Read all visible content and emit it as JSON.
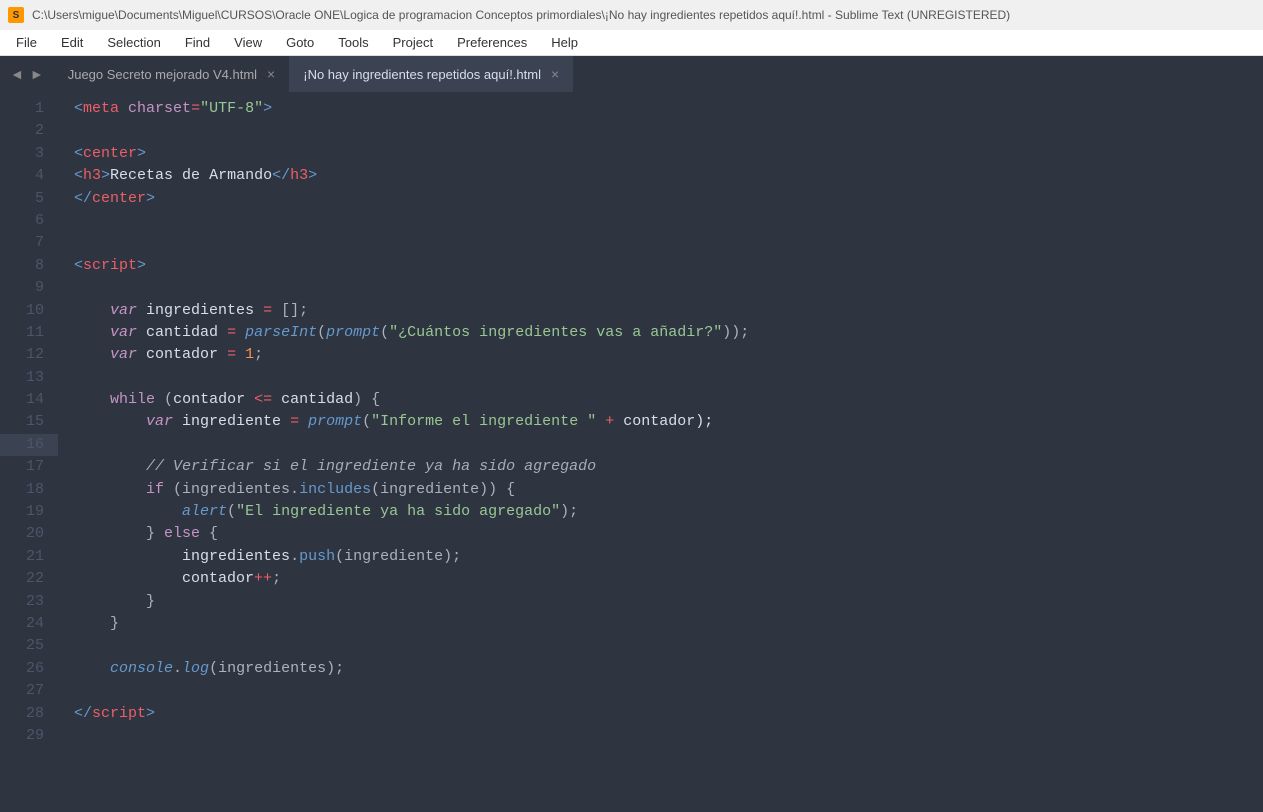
{
  "title_bar": "C:\\Users\\migue\\Documents\\Miguel\\CURSOS\\Oracle ONE\\Logica de programacion Conceptos primordiales\\¡No hay ingredientes repetidos aquí!.html - Sublime Text (UNREGISTERED)",
  "menu": [
    "File",
    "Edit",
    "Selection",
    "Find",
    "View",
    "Goto",
    "Tools",
    "Project",
    "Preferences",
    "Help"
  ],
  "tabs": [
    {
      "label": "Juego Secreto mejorado V4.html",
      "active": false
    },
    {
      "label": "¡No hay ingredientes repetidos aquí!.html",
      "active": true
    }
  ],
  "line_numbers": [
    1,
    2,
    3,
    4,
    5,
    6,
    7,
    8,
    9,
    10,
    11,
    12,
    13,
    14,
    15,
    16,
    17,
    18,
    19,
    20,
    21,
    22,
    23,
    24,
    25,
    26,
    27,
    28,
    29
  ],
  "modified_lines": [
    1,
    3,
    4,
    5,
    7,
    14,
    16,
    17,
    18,
    19,
    20,
    21,
    22,
    23,
    24,
    26
  ],
  "highlighted_line": 16,
  "code": {
    "l1": {
      "charset_attr": "charset",
      "charset_val": "\"UTF-8\""
    },
    "l4": {
      "text": "Recetas de Armando"
    },
    "l10": {
      "var": "var",
      "name": "ingredientes"
    },
    "l11": {
      "var": "var",
      "name": "cantidad",
      "fn": "parseInt",
      "prompt": "prompt",
      "str": "\"¿Cuántos ingredientes vas a añadir?\""
    },
    "l12": {
      "var": "var",
      "name": "contador",
      "num": "1"
    },
    "l14": {
      "kw": "while",
      "cond_l": "(contador ",
      "op": "<=",
      "cond_r": " cantidad) {"
    },
    "l15": {
      "var": "var",
      "name": "ingrediente",
      "prompt": "prompt",
      "str": "\"Informe el ingrediente \"",
      "op": "+",
      "tail": " contador);"
    },
    "l17": {
      "comment": "// Verificar si el ingrediente ya ha sido agregado"
    },
    "l18": {
      "kw": "if",
      "pre": " (ingredientes.",
      "fn": "includes",
      "args": "(ingrediente)) {"
    },
    "l19": {
      "fn": "alert",
      "str": "\"El ingrediente ya ha sido agregado\""
    },
    "l20": {
      "else": "else"
    },
    "l21": {
      "obj": "ingredientes.",
      "fn": "push",
      "args": "(ingrediente);"
    },
    "l22": {
      "name": "contador",
      "op": "++"
    },
    "l26": {
      "console": "console",
      "log": "log",
      "args": "(ingredientes);"
    }
  }
}
